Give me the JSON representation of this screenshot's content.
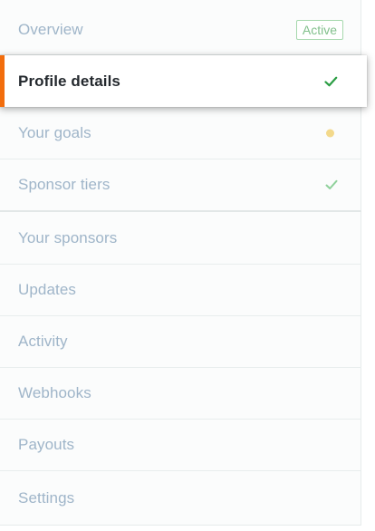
{
  "nav": {
    "overview": {
      "label": "Overview",
      "badge": "Active"
    },
    "profile_details": {
      "label": "Profile details"
    },
    "your_goals": {
      "label": "Your goals"
    },
    "sponsor_tiers": {
      "label": "Sponsor tiers"
    },
    "your_sponsors": {
      "label": "Your sponsors"
    },
    "updates": {
      "label": "Updates"
    },
    "activity": {
      "label": "Activity"
    },
    "webhooks": {
      "label": "Webhooks"
    },
    "payouts": {
      "label": "Payouts"
    },
    "settings": {
      "label": "Settings"
    }
  },
  "colors": {
    "accent": "#f26d0d",
    "check_dark": "#2a9d43",
    "check_light": "#8fd19b",
    "pending_dot": "#f3d98b",
    "muted_text": "#9fb5c9"
  },
  "icons": {
    "selected_status": "check-icon",
    "goals_status": "pending-dot-icon",
    "tiers_status": "check-icon"
  }
}
